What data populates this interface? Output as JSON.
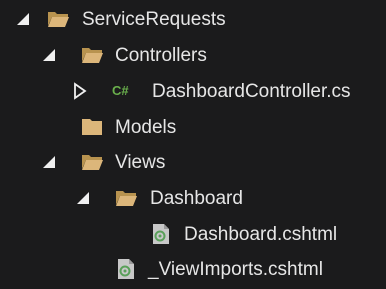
{
  "tree": {
    "nodes": [
      {
        "label": "ServiceRequests",
        "icon": "folder-open-icon",
        "expander": "expanded"
      },
      {
        "label": "Controllers",
        "icon": "folder-open-icon",
        "expander": "expanded"
      },
      {
        "label": "DashboardController.cs",
        "icon": "csharp-file-icon",
        "icon_text": "C#",
        "expander": "collapsed"
      },
      {
        "label": "Models",
        "icon": "folder-closed-icon",
        "expander": "none"
      },
      {
        "label": "Views",
        "icon": "folder-open-icon",
        "expander": "expanded"
      },
      {
        "label": "Dashboard",
        "icon": "folder-open-icon",
        "expander": "expanded"
      },
      {
        "label": "Dashboard.cshtml",
        "icon": "razor-file-icon",
        "expander": "none"
      },
      {
        "label": "_ViewImports.cshtml",
        "icon": "razor-file-icon",
        "expander": "none"
      }
    ]
  },
  "colors": {
    "background": "#1b1b1c",
    "text": "#e6e6e6",
    "folder": "#dcb67a",
    "folder_dark": "#b8934f",
    "csharp": "#6ab04c",
    "razor_file": "#c8c8c8",
    "razor_mark": "#5aa05a",
    "expander": "#f0f0f0"
  }
}
